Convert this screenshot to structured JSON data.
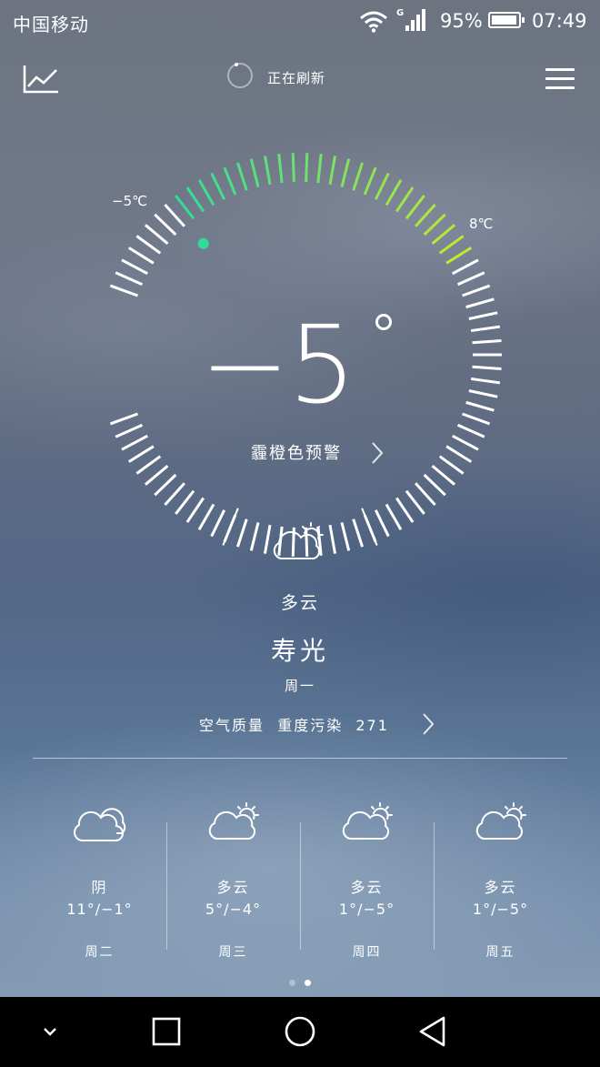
{
  "status_bar": {
    "carrier": "中国移动",
    "network_type": "G",
    "battery_percent": "95%",
    "battery_level": 0.95,
    "time": "07:49",
    "icons": [
      "wifi-icon",
      "signal-icon",
      "battery-icon"
    ]
  },
  "header": {
    "refresh_text": "正在刷新",
    "icons": [
      "trend-chart-icon",
      "spinner-icon",
      "menu-icon"
    ]
  },
  "dial": {
    "range_low_label": "−5℃",
    "range_high_label": "8℃",
    "range_low": -5,
    "range_high": 8,
    "current": -5,
    "colors": {
      "cold": "#2fdc9a",
      "warm": "#c6ea2a",
      "marker": "#2fdc9a"
    }
  },
  "current": {
    "temp": "−5",
    "warning": "霾橙色预警",
    "condition": "多云",
    "condition_icon": "partly-cloudy-icon",
    "city": "寿光",
    "weekday": "周一",
    "air_quality": {
      "label": "空气质量",
      "level": "重度污染",
      "value": "271"
    }
  },
  "forecast": [
    {
      "day": "周二",
      "condition": "阴",
      "range": "11°/−1°",
      "icon": "cloud-icon"
    },
    {
      "day": "周三",
      "condition": "多云",
      "range": "5°/−4°",
      "icon": "partly-cloudy-icon"
    },
    {
      "day": "周四",
      "condition": "多云",
      "range": "1°/−5°",
      "icon": "partly-cloudy-icon"
    },
    {
      "day": "周五",
      "condition": "多云",
      "range": "1°/−5°",
      "icon": "partly-cloudy-icon"
    }
  ],
  "pager": {
    "pages": 2,
    "active": 2
  },
  "nav_bar": {
    "icons": [
      "chevron-down-icon",
      "recents-icon",
      "home-icon",
      "back-icon"
    ]
  }
}
